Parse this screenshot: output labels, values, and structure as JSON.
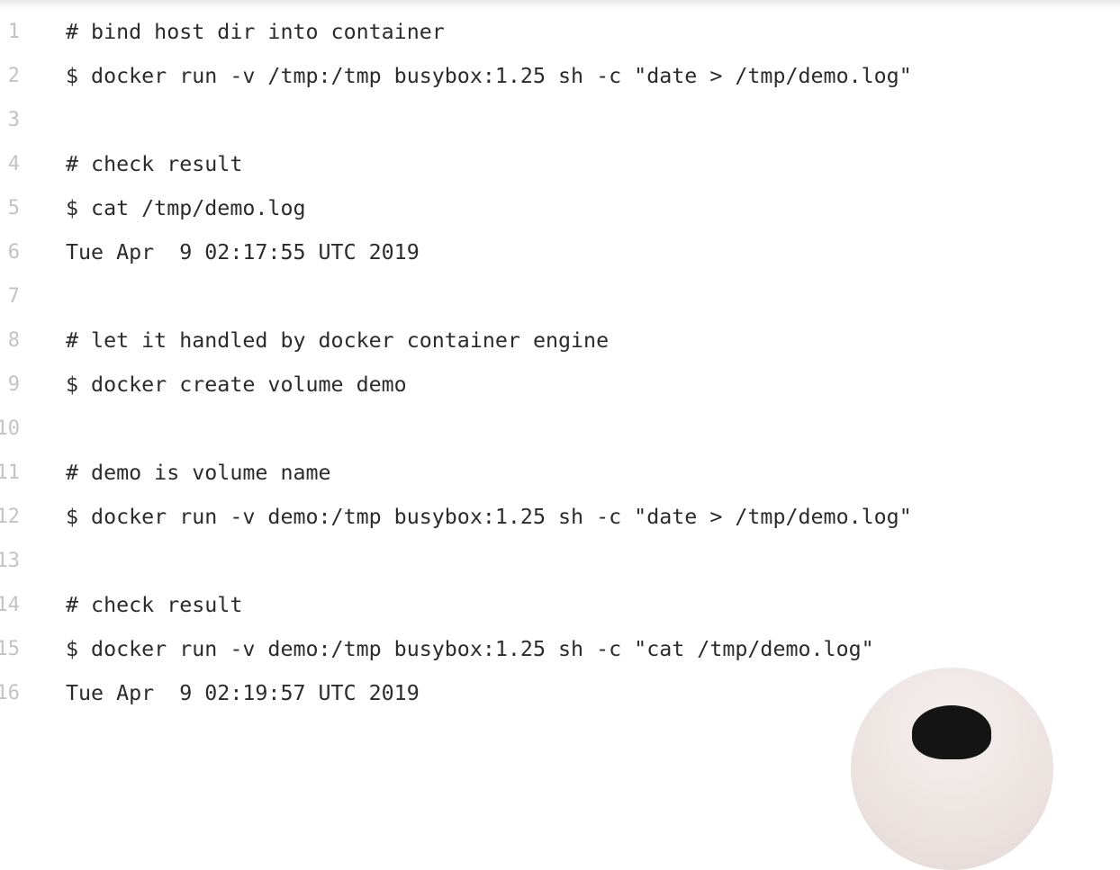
{
  "editor": {
    "lines": [
      {
        "number": "1",
        "text": "# bind host dir into container"
      },
      {
        "number": "2",
        "text": "$ docker run -v /tmp:/tmp busybox:1.25 sh -c \"date > /tmp/demo.log\""
      },
      {
        "number": "3",
        "text": ""
      },
      {
        "number": "4",
        "text": "# check result"
      },
      {
        "number": "5",
        "text": "$ cat /tmp/demo.log"
      },
      {
        "number": "6",
        "text": "Tue Apr  9 02:17:55 UTC 2019"
      },
      {
        "number": "7",
        "text": ""
      },
      {
        "number": "8",
        "text": "# let it handled by docker container engine"
      },
      {
        "number": "9",
        "text": "$ docker create volume demo"
      },
      {
        "number": "10",
        "text": ""
      },
      {
        "number": "11",
        "text": "# demo is volume name"
      },
      {
        "number": "12",
        "text": "$ docker run -v demo:/tmp busybox:1.25 sh -c \"date > /tmp/demo.log\""
      },
      {
        "number": "13",
        "text": ""
      },
      {
        "number": "14",
        "text": "# check result"
      },
      {
        "number": "15",
        "text": "$ docker run -v demo:/tmp busybox:1.25 sh -c \"cat /tmp/demo.log\""
      },
      {
        "number": "16",
        "text": "Tue Apr  9 02:19:57 UTC 2019"
      }
    ]
  },
  "colors": {
    "text": "#2b2b2b",
    "line_number": "#c3c3c3",
    "background": "#ffffff"
  },
  "icons": {
    "presenter": "presenter-webcam-overlay"
  }
}
